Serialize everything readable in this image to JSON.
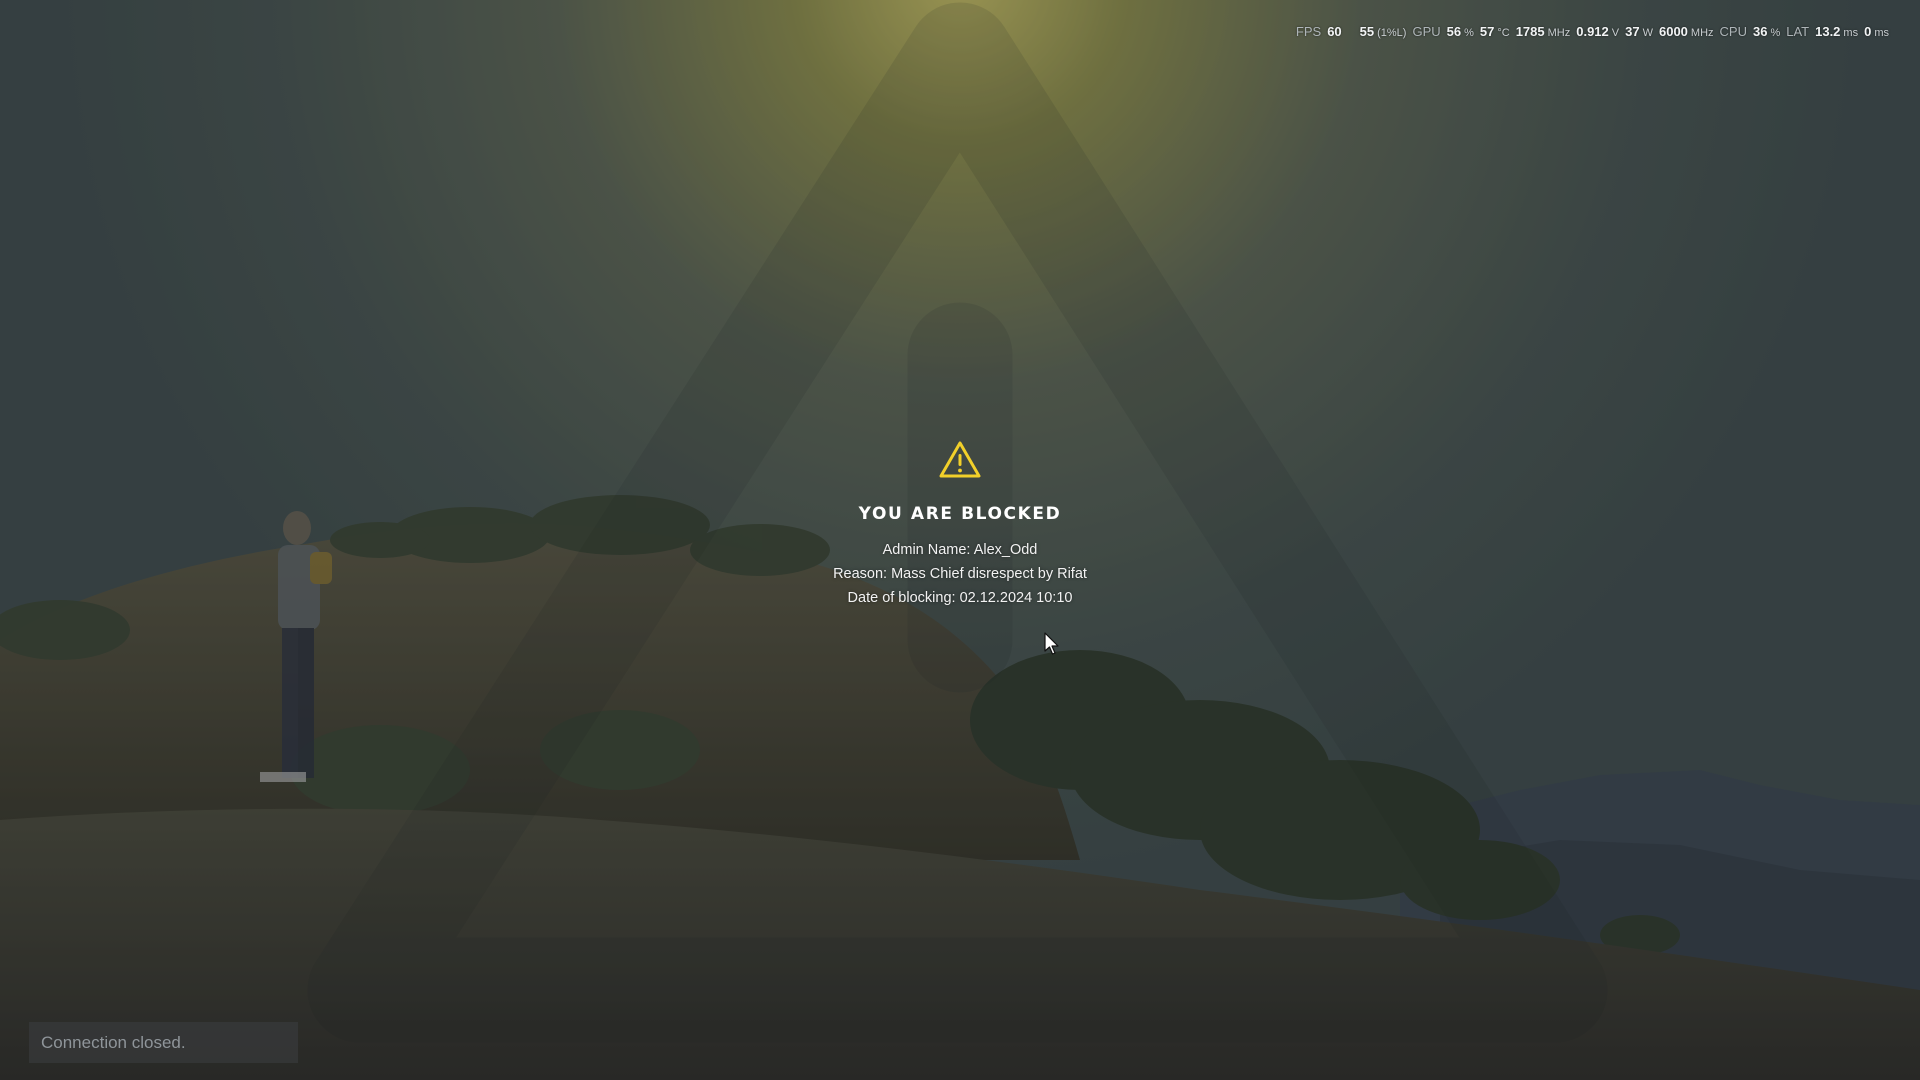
{
  "perf_hud": {
    "fps_label": "FPS",
    "fps_value": "60",
    "fps_low_value": "55",
    "fps_low_label": "(1%L)",
    "gpu_label": "GPU",
    "gpu_usage": "56",
    "gpu_usage_unit": "%",
    "gpu_temp": "57",
    "gpu_temp_unit": "°C",
    "gpu_clock": "1785",
    "gpu_clock_unit": "MHz",
    "gpu_voltage": "0.912",
    "gpu_voltage_unit": "V",
    "gpu_power": "37",
    "gpu_power_unit": "W",
    "mem_clock": "6000",
    "mem_clock_unit": "MHz",
    "cpu_label": "CPU",
    "cpu_usage": "36",
    "cpu_usage_unit": "%",
    "lat_label": "LAT",
    "latency": "13.2",
    "latency_unit": "ms",
    "latency2": "0",
    "latency2_unit": "ms"
  },
  "block_screen": {
    "icon": "warning-triangle-icon",
    "icon_color": "#f2d02a",
    "title": "YOU ARE BLOCKED",
    "admin_line": "Admin Name: Alex_Odd",
    "reason_line": "Reason: Mass Chief disrespect by Rifat",
    "date_line": "Date of blocking: 02.12.2024 10:10"
  },
  "connection": {
    "status_text": "Connection closed."
  },
  "colors": {
    "sky_glow": "#c9c063",
    "overlay_tint": "#1e2226"
  }
}
